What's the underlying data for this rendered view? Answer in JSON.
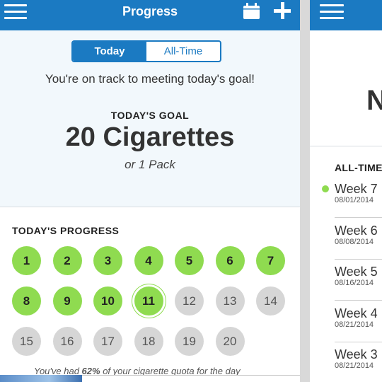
{
  "header": {
    "title": "Progress"
  },
  "tabs": [
    {
      "label": "Today",
      "active": true
    },
    {
      "label": "All-Time",
      "active": false
    }
  ],
  "goal": {
    "status_message": "You're on track to meeting today's goal!",
    "label": "TODAY'S GOAL",
    "value": "20 Cigarettes",
    "subtext": "or 1 Pack"
  },
  "progress": {
    "title": "TODAY'S PROGRESS",
    "items": [
      "1",
      "2",
      "3",
      "4",
      "5",
      "6",
      "7",
      "8",
      "9",
      "10",
      "11",
      "12",
      "13",
      "14",
      "15",
      "16",
      "17",
      "18",
      "19",
      "20"
    ],
    "completed_count": 10,
    "current": "11",
    "quota_prefix": "You've had ",
    "quota_percent": "62%",
    "quota_suffix": " of your cigarette quota for the day"
  },
  "right_screen": {
    "big_text": "N",
    "section_title": "ALL-TIME",
    "weeks": [
      {
        "name": "Week 7",
        "date": "08/01/2014"
      },
      {
        "name": "Week 6",
        "date": "08/08/2014"
      },
      {
        "name": "Week 5",
        "date": "08/16/2014"
      },
      {
        "name": "Week 4",
        "date": "08/21/2014"
      },
      {
        "name": "Week 3",
        "date": "08/21/2014"
      }
    ]
  },
  "colors": {
    "brand_blue": "#1b7ac2",
    "complete_green": "#8fdb50",
    "incomplete_gray": "#d6d6d6"
  },
  "icons": [
    "menu-icon",
    "calendar-icon",
    "plus-icon"
  ]
}
